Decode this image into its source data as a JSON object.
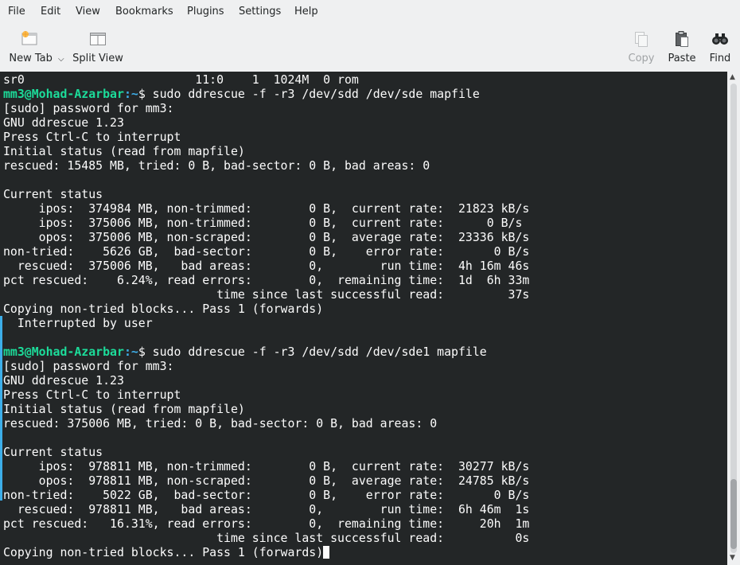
{
  "menubar": {
    "items": [
      "File",
      "Edit",
      "View",
      "Bookmarks",
      "Plugins",
      "Settings",
      "Help"
    ]
  },
  "toolbar": {
    "new_tab_label": "New Tab",
    "split_view_label": "Split View",
    "copy_label": "Copy",
    "paste_label": "Paste",
    "find_label": "Find"
  },
  "terminal": {
    "lines": [
      {
        "text": "sr0                        11:0    1  1024M  0 rom"
      },
      {
        "user": "mm3@Mohad-Azarbar",
        "path": ":~",
        "text": "$ sudo ddrescue -f -r3 /dev/sdd /dev/sde mapfile"
      },
      {
        "text": "[sudo] password for mm3:"
      },
      {
        "text": "GNU ddrescue 1.23"
      },
      {
        "text": "Press Ctrl-C to interrupt"
      },
      {
        "text": "Initial status (read from mapfile)"
      },
      {
        "text": "rescued: 15485 MB, tried: 0 B, bad-sector: 0 B, bad areas: 0"
      },
      {
        "text": ""
      },
      {
        "text": "Current status"
      },
      {
        "text": "     ipos:  374984 MB, non-trimmed:        0 B,  current rate:  21823 kB/s"
      },
      {
        "text": "     ipos:  375006 MB, non-trimmed:        0 B,  current rate:      0 B/s"
      },
      {
        "text": "     opos:  375006 MB, non-scraped:        0 B,  average rate:  23336 kB/s"
      },
      {
        "text": "non-tried:    5626 GB,  bad-sector:        0 B,    error rate:       0 B/s"
      },
      {
        "text": "  rescued:  375006 MB,   bad areas:        0,        run time:  4h 16m 46s"
      },
      {
        "text": "pct rescued:    6.24%, read errors:        0,  remaining time:  1d  6h 33m"
      },
      {
        "text": "                              time since last successful read:         37s"
      },
      {
        "text": "Copying non-tried blocks... Pass 1 (forwards)"
      },
      {
        "text": "  Interrupted by user"
      },
      {
        "text": ""
      },
      {
        "user": "mm3@Mohad-Azarbar",
        "path": ":~",
        "text": "$ sudo ddrescue -f -r3 /dev/sdd /dev/sde1 mapfile"
      },
      {
        "text": "[sudo] password for mm3:"
      },
      {
        "text": "GNU ddrescue 1.23"
      },
      {
        "text": "Press Ctrl-C to interrupt"
      },
      {
        "text": "Initial status (read from mapfile)"
      },
      {
        "text": "rescued: 375006 MB, tried: 0 B, bad-sector: 0 B, bad areas: 0"
      },
      {
        "text": ""
      },
      {
        "text": "Current status"
      },
      {
        "text": "     ipos:  978811 MB, non-trimmed:        0 B,  current rate:  30277 kB/s"
      },
      {
        "text": "     opos:  978811 MB, non-scraped:        0 B,  average rate:  24785 kB/s"
      },
      {
        "text": "non-tried:    5022 GB,  bad-sector:        0 B,    error rate:       0 B/s"
      },
      {
        "text": "  rescued:  978811 MB,   bad areas:        0,        run time:  6h 46m  1s"
      },
      {
        "text": "pct rescued:   16.31%, read errors:        0,  remaining time:     20h  1m"
      },
      {
        "text": "                              time since last successful read:          0s"
      },
      {
        "text": "Copying non-tried blocks... Pass 1 (forwards)",
        "cursor": true
      }
    ]
  },
  "colors": {
    "terminal_bg": "#232627",
    "terminal_fg": "#fcfcfc",
    "prompt_user": "#1cdc9a",
    "prompt_path": "#3daee9",
    "window_bg": "#eff0f1"
  }
}
